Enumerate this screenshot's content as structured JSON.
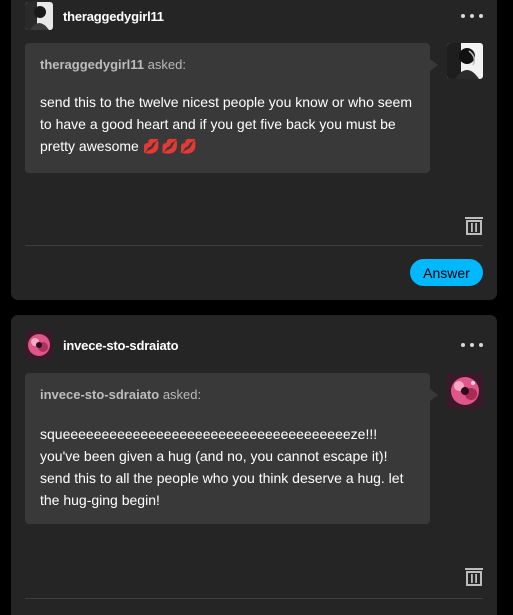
{
  "posts": [
    {
      "username": "theraggedygirl11",
      "asker": "theraggedygirl11",
      "asked_suffix": " asked:",
      "question": "send this to the twelve nicest people you know or who seem to have a good heart and if you get five back you must be pretty awesome ",
      "emoji": "💋💋💋",
      "answer_label": "Answer",
      "avatar_icon": "bw-portrait-avatar"
    },
    {
      "username": "invece-sto-sdraiato",
      "asker": "invece-sto-sdraiato",
      "asked_suffix": " asked:",
      "question": "squeeeeeeeeeeeeeeeeeeeeeeeeeeeeeeeeeeeeeze!!! you've been given a hug (and no, you cannot escape it)! send this to all the people who you think deserve a hug. let the hug-ging begin!",
      "avatar_icon": "pink-flower-avatar"
    }
  ],
  "colors": {
    "page_bg": "#000000",
    "card_bg": "#252525",
    "bubble_bg": "#393939",
    "accent": "#00b8ff"
  }
}
